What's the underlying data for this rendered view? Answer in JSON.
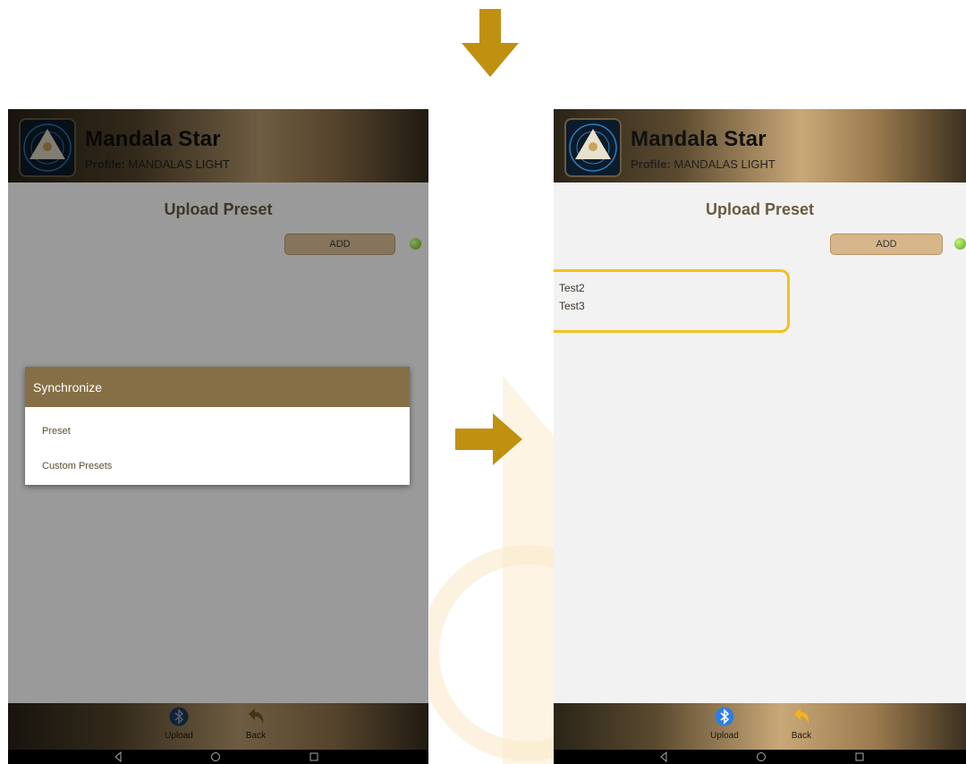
{
  "colors": {
    "accent": "#c09010",
    "highlight": "#f3c11d",
    "dialog_header": "#866f47"
  },
  "arrows": [
    "arrow-down",
    "arrow-right"
  ],
  "left_screen": {
    "app_title": "Mandala Star",
    "profile_label": "Profile:",
    "profile_value": "MANDALAS LIGHT",
    "page_title": "Upload Preset",
    "add_label": "ADD",
    "dialog": {
      "title": "Synchronize",
      "items": [
        "Preset",
        "Custom Presets"
      ]
    },
    "nav": {
      "upload_label": "Upload",
      "back_label": "Back"
    }
  },
  "right_screen": {
    "app_title": "Mandala Star",
    "profile_label": "Profile:",
    "profile_value": "MANDALAS LIGHT",
    "page_title": "Upload Preset",
    "add_label": "ADD",
    "presets": [
      "Test2",
      "Test3"
    ],
    "nav": {
      "upload_label": "Upload",
      "back_label": "Back"
    }
  },
  "icons": {
    "logo": "mandala-logo-icon",
    "upload": "bluetooth-icon",
    "back": "back-arrow-icon",
    "status": "connection-status-icon",
    "system": [
      "system-back-icon",
      "system-home-icon",
      "system-recents-icon"
    ]
  }
}
